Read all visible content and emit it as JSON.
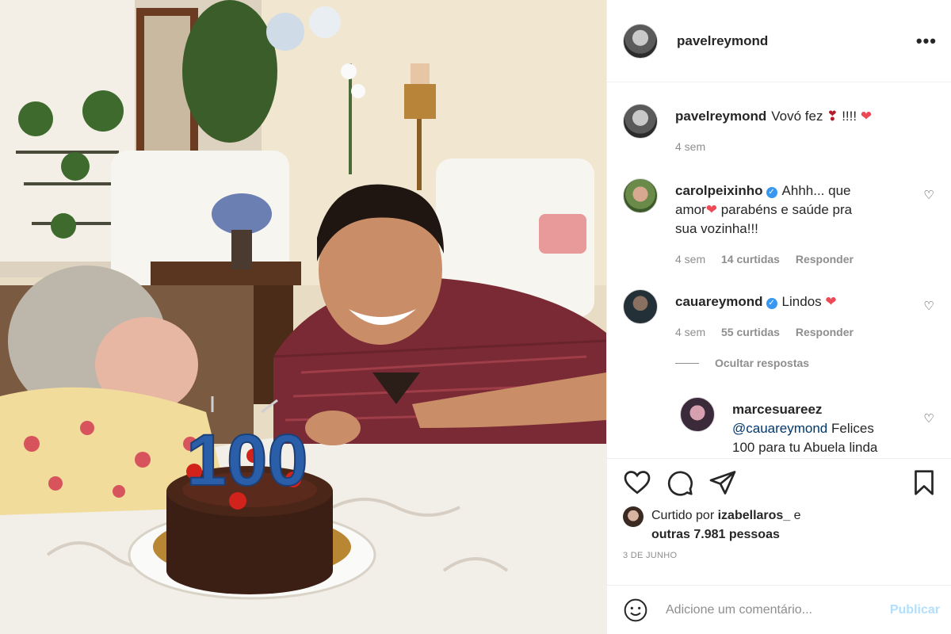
{
  "post": {
    "username": "pavelreymond",
    "more_icon": "ellipsis-icon",
    "caption": {
      "user": "pavelreymond",
      "text": "Vovó fez",
      "trail": "!!!!",
      "time": "4 sem"
    },
    "comments": [
      {
        "user": "carolpeixinho",
        "verified": true,
        "text_1": "Ahhh... que",
        "text_2": "amor",
        "text_3": "parabéns e saúde pra",
        "text_4": "sua vozinha!!!",
        "time": "4 sem",
        "likes": "14 curtidas",
        "reply": "Responder"
      },
      {
        "user": "cauareymond",
        "verified": true,
        "text": "Lindos",
        "time": "4 sem",
        "likes": "55 curtidas",
        "reply": "Responder"
      }
    ],
    "hide_replies": "Ocultar respostas",
    "reply": {
      "user": "marcesuareez",
      "mention": "@cauareymond",
      "text_1": "Felices",
      "text_2": "100 para tu Abuela linda"
    },
    "liked_by": {
      "prefix": "Curtido por",
      "user": "izabellaros_",
      "conj": "e",
      "others": "outras 7.981 pessoas"
    },
    "date": "3 DE JUNHO",
    "comment_placeholder": "Adicione um comentário...",
    "publish_label": "Publicar"
  },
  "photo": {
    "cake_candle_text": "100"
  },
  "colors": {
    "accent_blue": "#3897f0",
    "like_red": "#ed4956",
    "publish_disabled": "#b2dffc",
    "muted_text": "#8e8e8e"
  }
}
